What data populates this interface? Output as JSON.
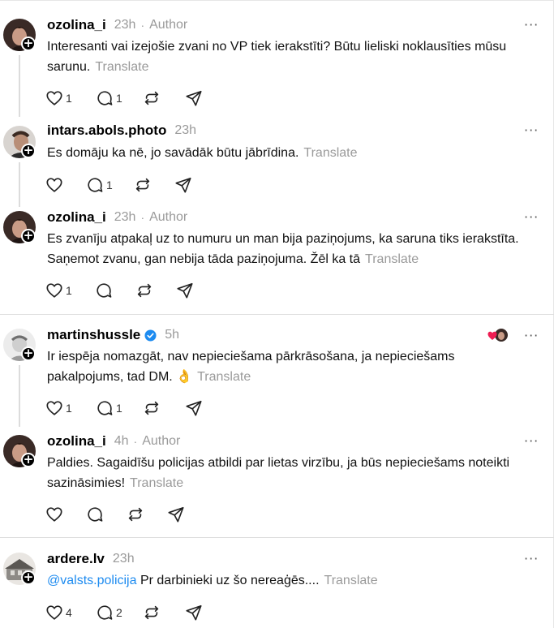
{
  "ui": {
    "more_label": "···",
    "translate_label": "Translate"
  },
  "posts": [
    {
      "username": "ozolina_i",
      "time": "23h",
      "dot": "·",
      "author": "Author",
      "text": "Interesanti vai izejošie zvani no VP tiek ierakstīti? Būtu lieliski noklausīties mūsu sarunu.",
      "likes": "1",
      "replies": "1"
    },
    {
      "username": "intars.abols.photo",
      "time": "23h",
      "text": "Es domāju ka nē, jo savādāk būtu jābrīdina.",
      "likes": "",
      "replies": "1"
    },
    {
      "username": "ozolina_i",
      "time": "23h",
      "dot": "·",
      "author": "Author",
      "text_line1": "Es zvanīju atpakaļ uz to numuru un man bija paziņojums, ka saruna tiks ierakstīta.",
      "text_line2": "Saņemot zvanu, gan nebija tāda paziņojuma. Žēl ka tā",
      "likes": "1",
      "replies": ""
    },
    {
      "username": "martinshussle",
      "verified": true,
      "time": "5h",
      "text_line1": "Ir iespēja nomazgāt, nav nepieciešama pārkrāsošana, ja nepieciešams",
      "text_line2": "pakalpojums, tad DM.",
      "emoji": "👌",
      "likes": "1",
      "replies": "1"
    },
    {
      "username": "ozolina_i",
      "time": "4h",
      "dot": "·",
      "author": "Author",
      "text_line1": "Paldies. Sagaidīšu policijas atbildi par lietas virzību, ja būs nepieciešams noteikti",
      "text_line2": "sazināsimies!",
      "likes": "",
      "replies": ""
    },
    {
      "username": "ardere.lv",
      "time": "23h",
      "mention": "@valsts.policija",
      "text": "Pr darbinieki uz šo nereaģēs....",
      "likes": "4",
      "replies": "2"
    }
  ]
}
